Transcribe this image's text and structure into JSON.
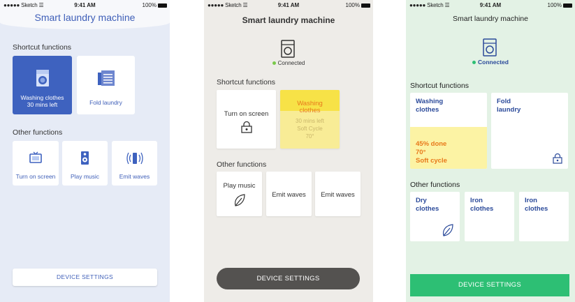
{
  "status_bar": {
    "carrier": "●●●●● Sketch ☰",
    "time": "9:41 AM",
    "battery": "100%"
  },
  "screen1": {
    "title": "Smart laundry machine",
    "shortcut_label": "Shortcut functions",
    "shortcuts": [
      {
        "label": "Washing clothes",
        "sublabel": "30 mins left",
        "icon": "washing-machine-icon"
      },
      {
        "label": "Fold laundry",
        "icon": "fold-laundry-icon"
      }
    ],
    "other_label": "Other functions",
    "others": [
      {
        "label": "Turn on screen",
        "icon": "tv-icon"
      },
      {
        "label": "Play music",
        "icon": "speaker-icon"
      },
      {
        "label": "Emit waves",
        "icon": "waves-icon"
      }
    ],
    "settings": "DEVICE SETTINGS",
    "colors": {
      "accent": "#3e62bf",
      "bg": "#e6ebf6"
    }
  },
  "screen2": {
    "title": "Smart laundry machine",
    "connected": "Connected",
    "shortcut_label": "Shortcut functions",
    "shortcuts": [
      {
        "label": "Turn on screen",
        "icon": "lock-icon"
      },
      {
        "label_1": "Washing",
        "label_2": "clothes",
        "sub_1": "30 mins left",
        "sub_2": "Soft Cycle",
        "sub_3": "70°"
      }
    ],
    "other_label": "Other functions",
    "others": [
      {
        "label": "Play music",
        "icon": "leaf-icon"
      },
      {
        "label": "Emit waves"
      },
      {
        "label": "Emit waves"
      }
    ],
    "settings": "DEVICE SETTINGS",
    "colors": {
      "active_bg": "#f8ec96",
      "button": "#545250",
      "connected_dot": "#7ac94b"
    }
  },
  "screen3": {
    "title": "Smart laundry machine",
    "connected": "Connected",
    "shortcut_label": "Shortcut functions",
    "shortcuts": [
      {
        "label_1": "Washing",
        "label_2": "clothes",
        "p1": "45% done",
        "p2": "70°",
        "p3": "Soft cycle"
      },
      {
        "label_1": "Fold",
        "label_2": "laundry",
        "icon": "lock-icon"
      }
    ],
    "other_label": "Other functions",
    "others": [
      {
        "label_1": "Dry",
        "label_2": "clothes",
        "icon": "leaf-icon"
      },
      {
        "label_1": "Iron",
        "label_2": "clothes"
      },
      {
        "label_1": "Iron",
        "label_2": "clothes"
      }
    ],
    "settings": "DEVICE SETTINGS",
    "colors": {
      "bg": "#e3f2e5",
      "button": "#2dbf74",
      "text": "#2b4a9a"
    }
  }
}
